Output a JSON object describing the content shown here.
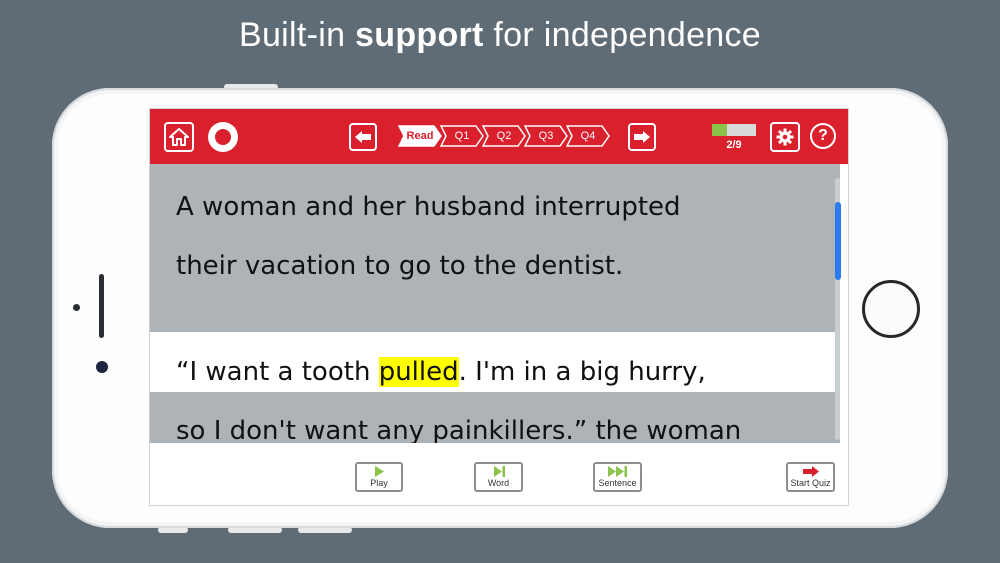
{
  "headline": {
    "pre": "Built-in ",
    "bold": "support",
    "post": " for independence"
  },
  "toolbar": {
    "steps": [
      "Read",
      "Q1",
      "Q2",
      "Q3",
      "Q4"
    ],
    "active_step": "Read",
    "progress_text": "2/9",
    "progress_fraction": 0.33,
    "help_label": "?"
  },
  "passage": {
    "line1": "A woman and her husband interrupted",
    "line2": "their vacation to go to the dentist.",
    "line3_pre": "“I want a tooth ",
    "line3_highlight": "pulled",
    "line3_post": ". I'm in a big hurry,",
    "line4": "so I don't want any painkillers.” the woman"
  },
  "controls": {
    "play": "Play",
    "word": "Word",
    "sentence": "Sentence",
    "start_quiz": "Start Quiz"
  },
  "colors": {
    "toolbar": "#da1f2d",
    "highlight": "#ffff00",
    "read_band": "#adb3b7",
    "play_green": "#8bc34a",
    "quiz_arrow": "#da1f2d",
    "scroll_thumb": "#2a7cf0"
  }
}
